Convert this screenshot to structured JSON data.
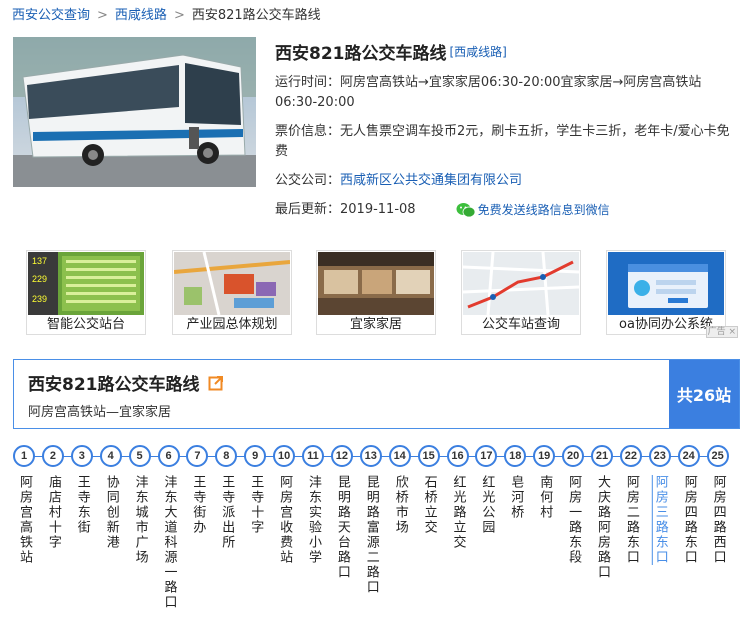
{
  "breadcrumb": {
    "home": "西安公交查询",
    "category": "西咸线路",
    "current": "西安821路公交车路线"
  },
  "info": {
    "title": "西安821路公交车路线",
    "tag": "[西咸线路]",
    "hours": "运行时间：阿房宫高铁站→宜家家居06:30-20:00宜家家居→阿房宫高铁站06:30-20:00",
    "fare": "票价信息：无人售票空调车投币2元，刷卡五折，学生卡三折，老年卡/爱心卡免费",
    "company_label": "公交公司：",
    "company": "西咸新区公共交通集团有限公司",
    "updated": "最后更新：2019-11-08",
    "wechat": "免费发送线路信息到微信"
  },
  "ads": [
    {
      "label": "智能公交站台",
      "icon": "bus-stop-screen-image"
    },
    {
      "label": "产业园总体规划",
      "icon": "master-plan-map-image"
    },
    {
      "label": "宜家家居",
      "icon": "ikea-store-image"
    },
    {
      "label": "公交车站查询",
      "icon": "route-map-image"
    },
    {
      "label": "oa协同办公系统",
      "icon": "oa-login-screen-image"
    }
  ],
  "ad_badge": "广告 ×",
  "route": {
    "title": "西安821路公交车路线",
    "subtitle": "阿房宫高铁站—宜家家居",
    "count": "共26站"
  },
  "stops": [
    {
      "n": "1",
      "name": "阿房宫高铁站"
    },
    {
      "n": "2",
      "name": "庙店村十字"
    },
    {
      "n": "3",
      "name": "王寺东街"
    },
    {
      "n": "4",
      "name": "协同创新港"
    },
    {
      "n": "5",
      "name": "沣东城市广场"
    },
    {
      "n": "6",
      "name": "沣东大道科源一路口"
    },
    {
      "n": "7",
      "name": "王寺街办"
    },
    {
      "n": "8",
      "name": "王寺派出所"
    },
    {
      "n": "9",
      "name": "王寺十字"
    },
    {
      "n": "10",
      "name": "阿房宫收费站"
    },
    {
      "n": "11",
      "name": "沣东实验小学"
    },
    {
      "n": "12",
      "name": "昆明路天台路口"
    },
    {
      "n": "13",
      "name": "昆明路富源二路口"
    },
    {
      "n": "14",
      "name": "欣桥市场"
    },
    {
      "n": "15",
      "name": "石桥立交"
    },
    {
      "n": "16",
      "name": "红光路立交"
    },
    {
      "n": "17",
      "name": "红光公园"
    },
    {
      "n": "18",
      "name": "皂河桥"
    },
    {
      "n": "19",
      "name": "南何村"
    },
    {
      "n": "20",
      "name": "阿房一路东段"
    },
    {
      "n": "21",
      "name": "大庆路阿房路口"
    },
    {
      "n": "22",
      "name": "阿房二路东口"
    },
    {
      "n": "23",
      "name": "阿房三路东口"
    },
    {
      "n": "24",
      "name": "阿房四路东口"
    },
    {
      "n": "25",
      "name": "阿房四路西口"
    }
  ],
  "colors": {
    "accent": "#3b7fe0",
    "link": "#1a5fb4"
  }
}
